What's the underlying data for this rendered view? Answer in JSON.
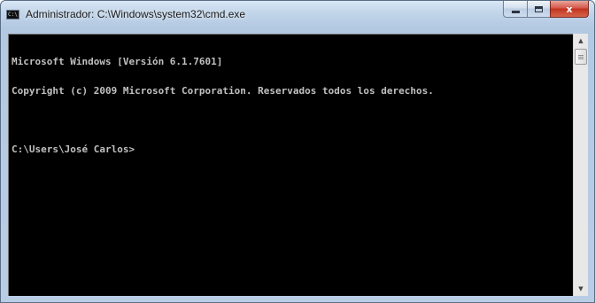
{
  "window": {
    "title": "Administrador: C:\\Windows\\system32\\cmd.exe",
    "icon": "cmd-icon",
    "icon_text": "C:\\",
    "buttons": {
      "minimize": "minimize-icon",
      "maximize": "maximize-icon",
      "close_glyph": "x"
    }
  },
  "console": {
    "lines": [
      "Microsoft Windows [Versión 6.1.7601]",
      "Copyright (c) 2009 Microsoft Corporation. Reservados todos los derechos.",
      "",
      "C:\\Users\\José Carlos>"
    ],
    "colors": {
      "background": "#000000",
      "foreground": "#c0c0c0"
    }
  },
  "scrollbar": {
    "up_arrow": "▲",
    "down_arrow": "▼"
  }
}
